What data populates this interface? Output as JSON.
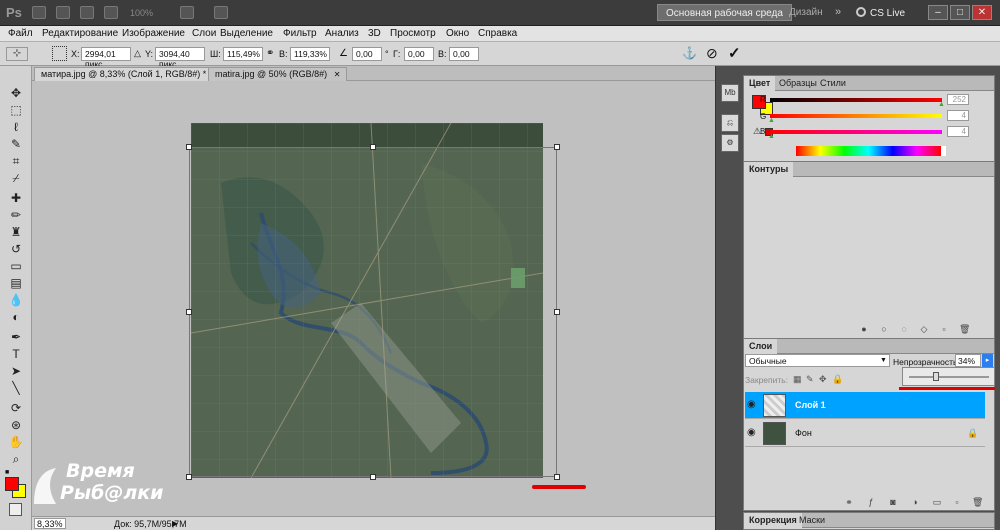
{
  "appbar": {
    "logo": "Ps",
    "zoom": "100%",
    "workspace_main": "Основная рабочая среда",
    "workspace_design": "Дизайн",
    "chevron": "»",
    "cs_live": "CS Live",
    "win_min": "–",
    "win_max": "□",
    "win_close": "✕"
  },
  "menu": [
    "Файл",
    "Редактирование",
    "Изображение",
    "Слои",
    "Выделение",
    "Фильтр",
    "Анализ",
    "3D",
    "Просмотр",
    "Окно",
    "Справка"
  ],
  "options": {
    "x_label": "X:",
    "x_value": "2994,01 пикс",
    "y_label": "Y:",
    "y_value": "3094,40 пикс",
    "w_label": "Ш:",
    "w_value": "115,49%",
    "h_label": "В:",
    "h_value": "119,33%",
    "angle_value": "0,00",
    "angle_unit": "°",
    "hskew_label": "Г:",
    "hskew_value": "0,00",
    "vskew_label": "В:",
    "vskew_value": "0,00",
    "cancel_icon": "⊘",
    "commit_icon": "✓"
  },
  "tabs": [
    {
      "label": "матира.jpg @ 8,33% (Слой 1, RGB/8#) *",
      "close": "✕",
      "active": true
    },
    {
      "label": "matira.jpg @ 50% (RGB/8#)",
      "close": "✕",
      "active": false
    }
  ],
  "status": {
    "zoom": "8,33%",
    "doc": "Док: 95,7M/95,7M"
  },
  "watermark": {
    "line1": "Время",
    "line2": "Рыб@лки"
  },
  "color_panel": {
    "tabs": [
      "Цвет",
      "Образцы",
      "Стили"
    ],
    "r_label": "R",
    "r_value": "252",
    "g_label": "G",
    "g_value": "4",
    "b_label": "B",
    "b_value": "4",
    "foreground": "#fc0404",
    "background": "#ffff00"
  },
  "paths_panel": {
    "tabs": [
      "Контуры"
    ]
  },
  "layers_panel": {
    "tabs": [
      "Слои"
    ],
    "blend_mode": "Обычные",
    "opacity_label": "Непрозрачность:",
    "opacity_value": "34%",
    "opacity_fraction": 0.34,
    "lock_label": "Закрепить:",
    "layers": [
      {
        "name": "Слой 1",
        "selected": true
      },
      {
        "name": "Фон",
        "selected": false,
        "locked": true
      }
    ]
  },
  "correction_panel": {
    "tabs": [
      "Коррекция",
      "Маски"
    ]
  },
  "accent_color": "#00a2ff",
  "annotation_color": "#e00000"
}
